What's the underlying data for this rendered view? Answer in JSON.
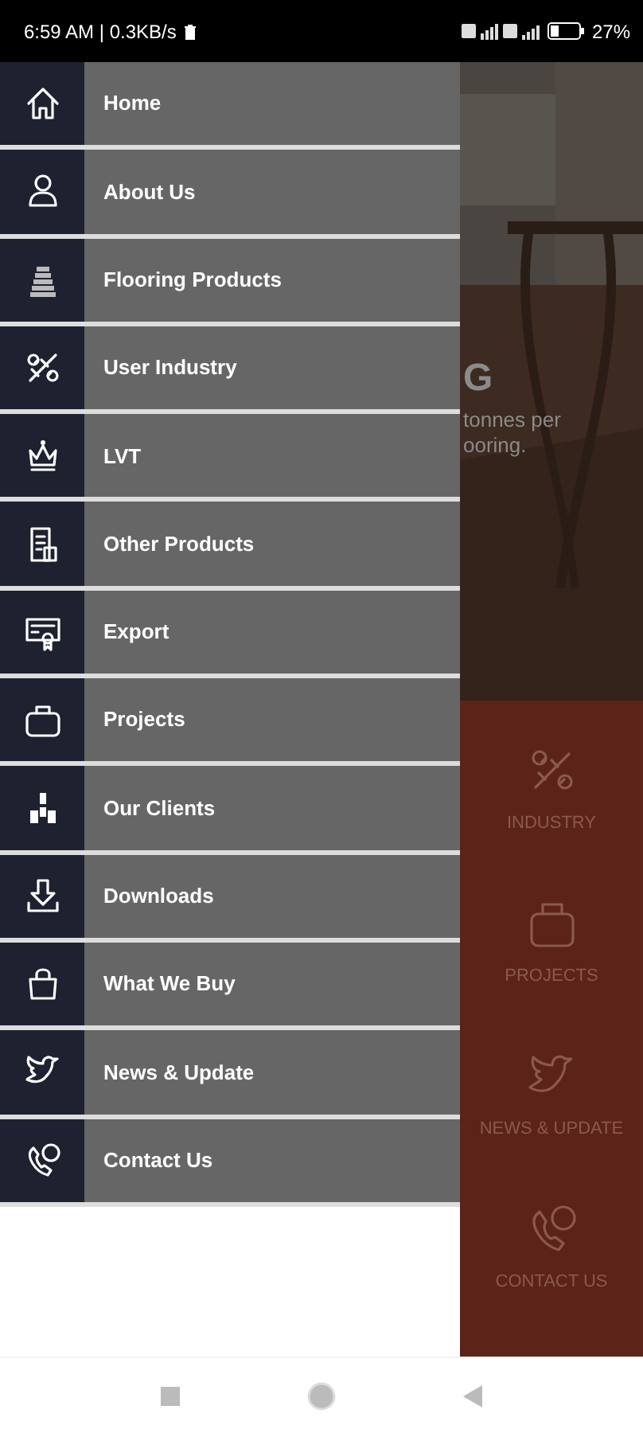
{
  "status_bar": {
    "time": "6:59 AM | 0.3KB/s",
    "battery": "27%"
  },
  "drawer": {
    "items": [
      {
        "label": "Home"
      },
      {
        "label": "About Us"
      },
      {
        "label": "Flooring Products"
      },
      {
        "label": "User Industry"
      },
      {
        "label": "LVT"
      },
      {
        "label": "Other Products"
      },
      {
        "label": "Export"
      },
      {
        "label": "Projects"
      },
      {
        "label": "Our Clients"
      },
      {
        "label": "Downloads"
      },
      {
        "label": "What We Buy"
      },
      {
        "label": "News & Update"
      },
      {
        "label": "Contact Us"
      }
    ]
  },
  "background": {
    "heading_fragment": "G",
    "text_lines": [
      "tonnes per",
      "ooring."
    ],
    "tiles": [
      {
        "label": "INDUSTRY"
      },
      {
        "label": "PROJECTS"
      },
      {
        "label": "NEWS & UPDATE"
      },
      {
        "label": "CONTACT US"
      }
    ]
  }
}
